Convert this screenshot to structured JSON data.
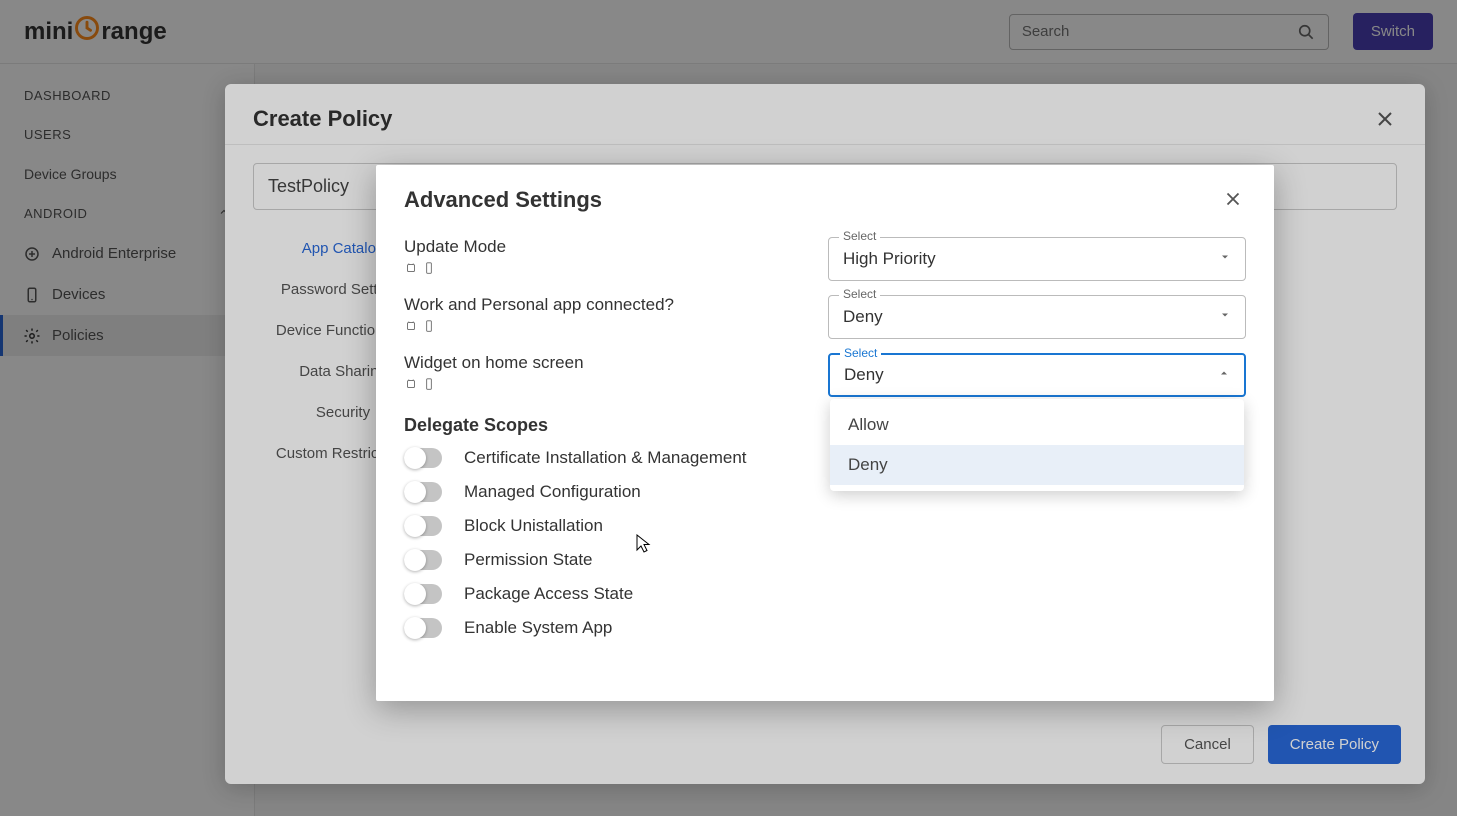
{
  "header": {
    "logo_prefix": "mini",
    "logo_accent": "🍊",
    "logo_suffix": "range",
    "search_placeholder": "Search",
    "switch_label": "Switch"
  },
  "sidebar": {
    "items": [
      {
        "label": "DASHBOARD",
        "type": "heading"
      },
      {
        "label": "USERS",
        "type": "heading"
      },
      {
        "label": "Device Groups",
        "type": "link"
      },
      {
        "label": "ANDROID",
        "type": "heading",
        "expandable": true
      },
      {
        "label": "Android Enterprise",
        "type": "sub",
        "icon": "google"
      },
      {
        "label": "Devices",
        "type": "sub",
        "icon": "phone"
      },
      {
        "label": "Policies",
        "type": "sub",
        "icon": "gear",
        "active": true
      }
    ]
  },
  "modal_policy": {
    "title": "Create Policy",
    "name_value": "TestPolicy",
    "tabs": [
      "App Catalog",
      "Password Settings",
      "Device Functionality",
      "Data Sharing",
      "Security",
      "Custom Restrictions"
    ],
    "active_tab": 0,
    "cancel_label": "Cancel",
    "create_label": "Create Policy"
  },
  "modal_adv": {
    "title": "Advanced Settings",
    "rows": [
      {
        "label": "Update Mode",
        "select_label": "Select",
        "value": "High Priority"
      },
      {
        "label": "Work and Personal app connected?",
        "select_label": "Select",
        "value": "Deny"
      },
      {
        "label": "Widget on home screen",
        "select_label": "Select",
        "value": "Deny",
        "open": true
      }
    ],
    "dropdown_options": [
      "Allow",
      "Deny"
    ],
    "dropdown_selected": "Deny",
    "delegate_heading": "Delegate Scopes",
    "toggles": [
      "Certificate Installation & Management",
      "Managed Configuration",
      "Block Unistallation",
      "Permission State",
      "Package Access State",
      "Enable System App"
    ]
  }
}
